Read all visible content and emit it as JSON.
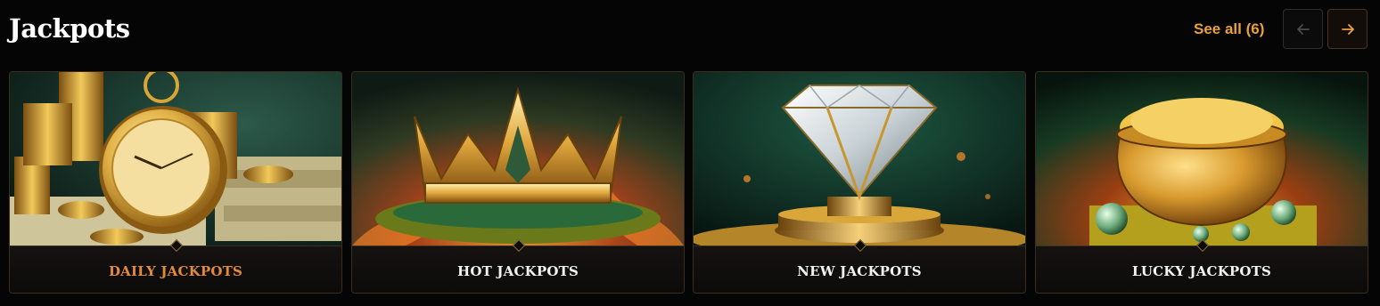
{
  "header": {
    "title": "Jackpots",
    "see_all_label": "See all (6)",
    "prev_icon": "arrow-left-icon",
    "next_icon": "arrow-right-icon"
  },
  "colors": {
    "accent": "#e9a13b",
    "active_label": "#e48a3c",
    "background": "#050505",
    "card_border": "#3a2e22"
  },
  "cards": [
    {
      "label": "DAILY JACKPOTS",
      "art": "gold-pocket-watch-with-coins",
      "active": true
    },
    {
      "label": "HOT JACKPOTS",
      "art": "golden-crown-on-flames",
      "active": false
    },
    {
      "label": "NEW JACKPOTS",
      "art": "diamond-on-gold-pedestal",
      "active": false
    },
    {
      "label": "LUCKY JACKPOTS",
      "art": "pot-of-gold-coins",
      "active": false
    }
  ]
}
